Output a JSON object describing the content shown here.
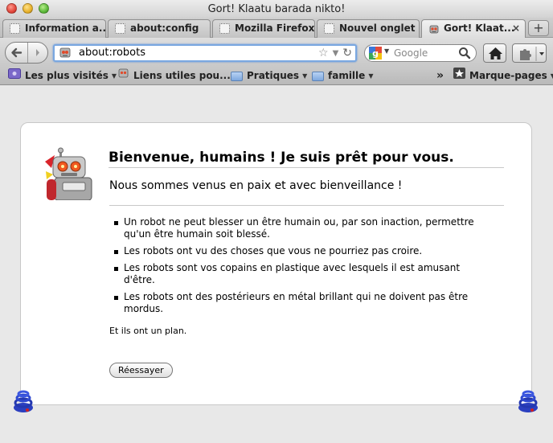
{
  "window": {
    "title": "Gort! Klaatu barada nikto!"
  },
  "tabs": [
    {
      "label": "Information a...",
      "active": false
    },
    {
      "label": "about:config",
      "active": false
    },
    {
      "label": "Mozilla Firefox",
      "active": false
    },
    {
      "label": "Nouvel onglet",
      "active": false
    },
    {
      "label": "Gort! Klaat...",
      "active": true
    }
  ],
  "newtab": {
    "label": "+"
  },
  "navbar": {
    "url": "about:robots",
    "search_placeholder": "Google"
  },
  "bookmarks": [
    {
      "label": "Les plus visités",
      "dropdown": true
    },
    {
      "label": "Liens utiles pou...",
      "dropdown": true
    },
    {
      "label": "Pratiques",
      "dropdown": true
    },
    {
      "label": "famille",
      "dropdown": true
    },
    {
      "label": "Marque-pages",
      "dropdown": true
    }
  ],
  "bookmarks_overflow": "»",
  "page": {
    "heading": "Bienvenue, humains ! Je suis prêt pour vous.",
    "subheading": "Nous sommes venus en paix et avec bienveillance !",
    "laws": [
      "Un robot ne peut blesser un être humain ou, par son inaction, permettre qu'un être humain soit blessé.",
      "Les robots ont vu des choses que vous ne pourriez pas croire.",
      "Les robots sont vos copains en plastique avec lesquels il est amusant d'être.",
      "Les robots ont des postérieurs en métal brillant qui ne doivent pas être mordus."
    ],
    "plan": "Et ils ont un plan.",
    "retry_label": "Réessayer"
  }
}
